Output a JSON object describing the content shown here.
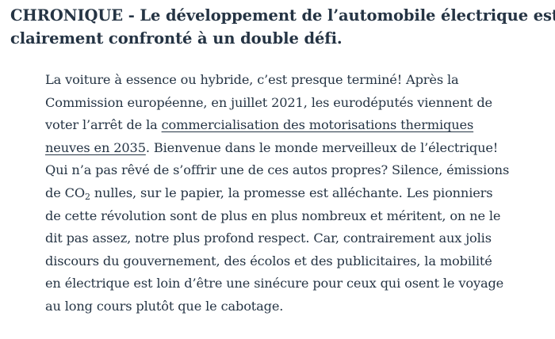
{
  "article": {
    "headline": {
      "line1": "CHRONIQUE - Le développement de l’automobile électrique est",
      "line2": "clairement confronté à un double défi."
    },
    "paragraph": {
      "l1": "La voiture à essence ou hybride, c’est presque terminé! Après la",
      "l2": "Commission européenne, en juillet 2021, les eurodéputés viennent de",
      "l3_before": "voter l’arrêt de la ",
      "link_part1": "commercialisation des motorisations thermiques",
      "link_part2": "neuves en 2035",
      "l4_after": ". Bienvenue dans le monde merveilleux de l’électrique!",
      "l5": "Qui n’a pas rêvé de s’offrir une de ces autos propres? Silence, émissions",
      "l6_before": "de CO",
      "co2_subscript": "2",
      "l6_after": " nulles, sur le papier, la promesse est alléchante. Les pionniers",
      "l7": "de cette révolution sont de plus en plus nombreux et méritent, on ne le",
      "l8": "dit pas assez, notre plus profond respect. Car, contrairement aux jolis",
      "l9": "discours du gouvernement, des écolos et des publicitaires, la mobilité",
      "l10": "en électrique est loin d’être une sinécure pour ceux qui osent le voyage",
      "l11": "au long cours plutôt que le cabotage."
    }
  },
  "colors": {
    "text": "#253444",
    "background": "#ffffff"
  }
}
